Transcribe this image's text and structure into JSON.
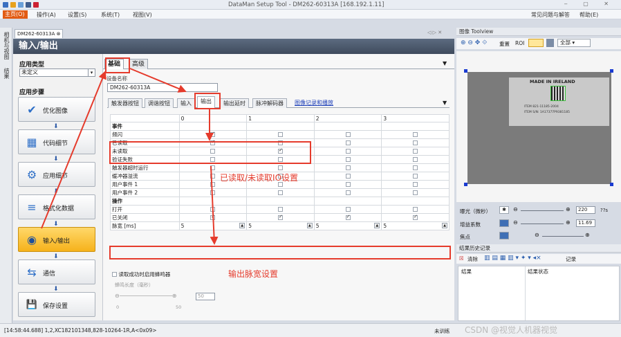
{
  "app": {
    "title": "DataMan Setup Tool - DM262-60313A [168.192.1.11]",
    "help_faq": "常见问题与解答",
    "help_menu": "帮助(E)"
  },
  "menu": {
    "home": "主页(O)",
    "items": [
      "操作(A)",
      "设置(S)",
      "系统(T)",
      "视图(V)"
    ]
  },
  "side_strip": [
    "相机与视图",
    "结果"
  ],
  "doc_tab": "DM262-60313A",
  "page_title": "输入/输出",
  "left": {
    "app_type_label": "应用类型",
    "app_type_value": "未定义",
    "steps_label": "应用步骤",
    "steps": [
      {
        "label": "优化图像",
        "icon": "✔"
      },
      {
        "label": "代码细节",
        "icon": "▦"
      },
      {
        "label": "应用细节",
        "icon": "⚙"
      },
      {
        "label": "格式化数据",
        "icon": "≡"
      },
      {
        "label": "输入/输出",
        "icon": "◉"
      },
      {
        "label": "通信",
        "icon": "⇆"
      },
      {
        "label": "保存设置",
        "icon": "💾"
      }
    ]
  },
  "tabs": [
    "基础",
    "高级"
  ],
  "device_name_label": "设备名称",
  "device_name_value": "DM262-60313A",
  "subtabs": [
    "触发器按钮",
    "调谐按钮",
    "输入",
    "输出",
    "输出延时",
    "脉冲解码器",
    "图像记录和播放"
  ],
  "grid": {
    "columns": [
      "",
      "0",
      "1",
      "2",
      "3"
    ],
    "rows": [
      {
        "label": "事件",
        "section": true
      },
      {
        "label": "频闪",
        "checks": [
          true,
          false,
          false,
          false
        ]
      },
      {
        "label": "已读取",
        "checks": [
          true,
          false,
          false,
          false
        ]
      },
      {
        "label": "未读取",
        "checks": [
          false,
          true,
          false,
          false
        ]
      },
      {
        "label": "验证失败",
        "checks": [
          false,
          false,
          false,
          false
        ]
      },
      {
        "label": "触发器超时运行",
        "checks": [
          false,
          false,
          false,
          false
        ]
      },
      {
        "label": "缓冲器溢流",
        "checks": [
          false,
          false,
          false,
          false
        ]
      },
      {
        "label": "用户事件 1",
        "checks": [
          false,
          false,
          false,
          false
        ]
      },
      {
        "label": "用户事件 2",
        "checks": [
          false,
          false,
          false,
          false
        ]
      },
      {
        "label": "操作",
        "section": true
      },
      {
        "label": "打开",
        "checks": [
          false,
          false,
          false,
          false
        ]
      },
      {
        "label": "已关闭",
        "checks": [
          true,
          true,
          true,
          true
        ]
      }
    ],
    "pulse_label": "脉宽 [ms]",
    "pulse_values": [
      "5",
      "5",
      "5",
      "5"
    ]
  },
  "annotations": {
    "read_io": "已读取/未读取IO设置",
    "pulse": "输出脉宽设置"
  },
  "beeper": {
    "checkbox_label": "读取成功时启用蜂鸣器",
    "length_label": "蜂鸣长度（毫秒）",
    "value": "50",
    "min": "0",
    "max": "50"
  },
  "right": {
    "toolview_title": "图像 Toolview",
    "reset_label": "重置",
    "roi_label": "ROI",
    "all_option": "全部",
    "photo_text": [
      "MADE IN IRELAND",
      "ITEM 821-11185-2004",
      "ITEM S/N: 1A17377P9381185"
    ],
    "exposure_label": "曝光（微秒）",
    "exposure_value": "220",
    "exposure_unit": "??s",
    "gain_label": "增益系数",
    "gain_value": "11.69",
    "focus_label": "焦点",
    "history_title": "结果历史记录",
    "clear_label": "清除",
    "record_label": "记录",
    "table_headers": [
      "结果",
      "结果状态"
    ]
  },
  "status": {
    "left": "[14:58:44.688] 1,2,XC182101348,828-10264-1R,A<0x09>",
    "right": "未训练",
    "watermark": "CSDN @视觉人机器视觉"
  },
  "colors": {
    "accent": "#e25b13",
    "annotation": "#e53b2c",
    "active_step": "#f6b21b",
    "header": "#4a5669"
  }
}
